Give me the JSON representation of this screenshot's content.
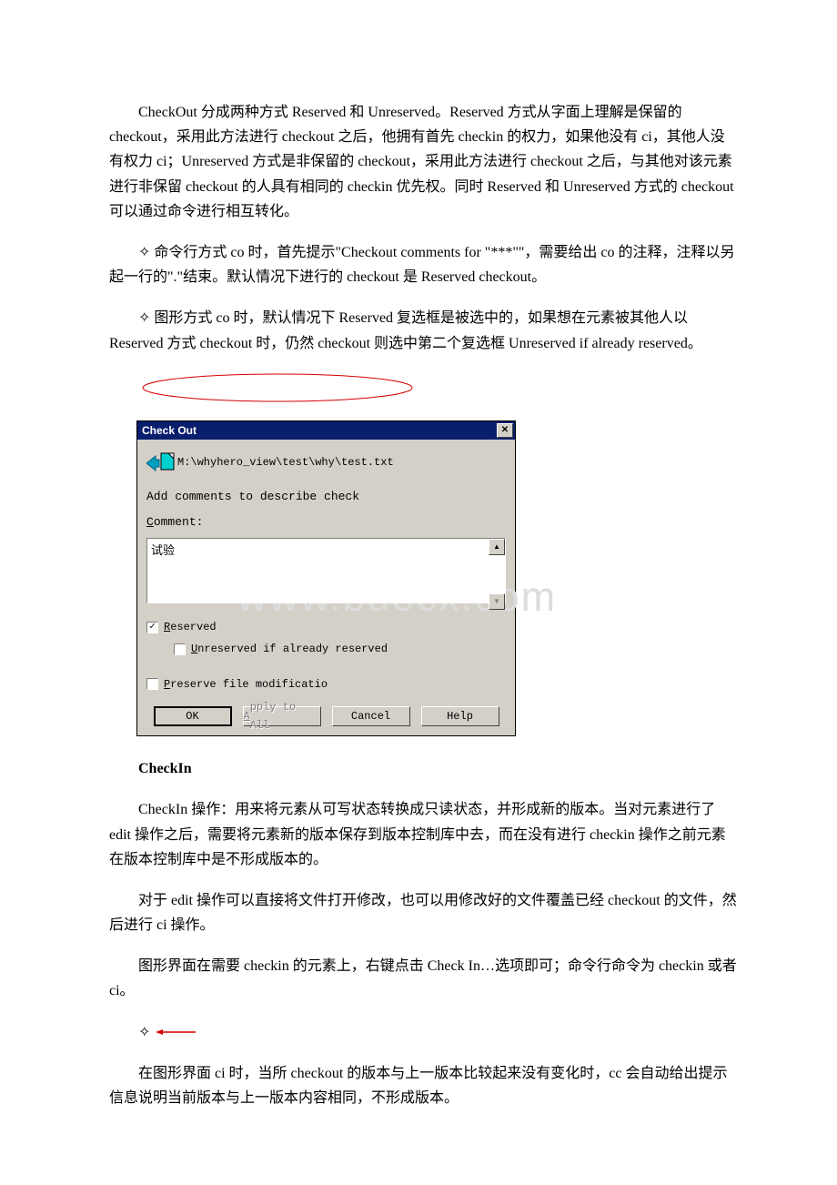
{
  "para1": "　　CheckOut 分成两种方式 Reserved 和 Unreserved。Reserved 方式从字面上理解是保留的 checkout，采用此方法进行 checkout 之后，他拥有首先 checkin 的权力，如果他没有 ci，其他人没有权力 ci；Unreserved 方式是非保留的 checkout，采用此方法进行 checkout 之后，与其他对该元素进行非保留 checkout 的人具有相同的 checkin 优先权。同时 Reserved 和 Unreserved 方式的 checkout 可以通过命令进行相互转化。",
  "para2": "　　✧ 命令行方式 co 时，首先提示\"Checkout comments for \"***\"\"，需要给出 co 的注释，注释以另起一行的\".\"结束。默认情况下进行的 checkout 是 Reserved checkout。",
  "para3": "　　✧ 图形方式 co 时，默认情况下 Reserved 复选框是被选中的，如果想在元素被其他人以 Reserved 方式 checkout 时，仍然 checkout 则选中第二个复选框 Unreserved if already reserved。",
  "dialog": {
    "title": "Check Out",
    "file_path": "M:\\whyhero_view\\test\\why\\test.txt",
    "desc": "Add comments to describe check",
    "comment_label_pre": "C",
    "comment_label_post": "omment:",
    "comment_value": "试验",
    "reserved_pre": "R",
    "reserved_post": "eserved",
    "unreserved_pre": "U",
    "unreserved_post": "nreserved if already reserved",
    "preserve_pre": "P",
    "preserve_post": "reserve file modificatio",
    "ok": "OK",
    "apply_pre": "A",
    "apply_post": "pply to All",
    "cancel": "Cancel",
    "help": "Help"
  },
  "watermark": "www.bdocx.com",
  "heading_checkin": "CheckIn",
  "para4": "　　CheckIn 操作：用来将元素从可写状态转换成只读状态，并形成新的版本。当对元素进行了 edit 操作之后，需要将元素新的版本保存到版本控制库中去，而在没有进行 checkin 操作之前元素在版本控制库中是不形成版本的。",
  "para5": "　　对于 edit 操作可以直接将文件打开修改，也可以用修改好的文件覆盖已经 checkout 的文件，然后进行 ci 操作。",
  "para6": "　　图形界面在需要 checkin 的元素上，右键点击 Check In…选项即可；命令行命令为 checkin 或者 ci。",
  "diamond_solo": "✧",
  "para7": "　　在图形界面 ci 时，当所 checkout 的版本与上一版本比较起来没有变化时，cc 会自动给出提示信息说明当前版本与上一版本内容相同，不形成版本。"
}
